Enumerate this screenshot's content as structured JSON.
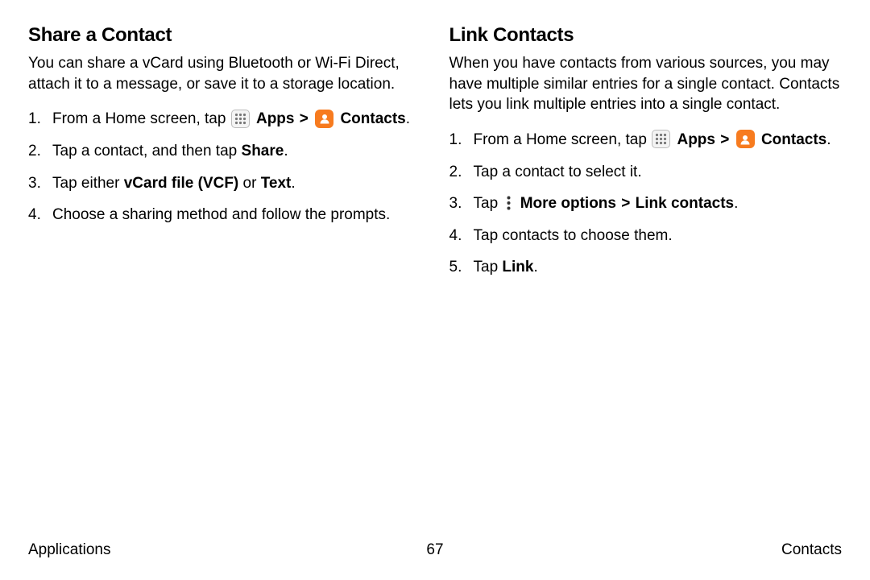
{
  "left": {
    "heading": "Share a Contact",
    "intro": "You can share a vCard using Bluetooth or Wi-Fi Direct, attach it to a message, or save it to a storage location.",
    "steps": {
      "s1_a": "From a Home screen, tap ",
      "s1_apps": "Apps",
      "s1_chev": ">",
      "s1_contacts": "Contacts",
      "s1_end": ".",
      "s2_a": "Tap a contact, and then tap ",
      "s2_b": "Share",
      "s2_end": ".",
      "s3_a": "Tap either ",
      "s3_b": "vCard file (VCF)",
      "s3_c": " or ",
      "s3_d": "Text",
      "s3_end": ".",
      "s4": "Choose a sharing method and follow the prompts."
    }
  },
  "right": {
    "heading": "Link Contacts",
    "intro": "When you have contacts from various sources, you may have multiple similar entries for a single contact. Contacts lets you link multiple entries into a single contact.",
    "steps": {
      "s1_a": "From a Home screen, tap ",
      "s1_apps": "Apps",
      "s1_chev": ">",
      "s1_contacts": "Contacts",
      "s1_end": ".",
      "s2": "Tap a contact to select it.",
      "s3_a": "Tap ",
      "s3_b": "More options",
      "s3_chev": ">",
      "s3_c": "Link contacts",
      "s3_end": ".",
      "s4": "Tap contacts to choose them.",
      "s5_a": "Tap ",
      "s5_b": "Link",
      "s5_end": "."
    }
  },
  "footer": {
    "left": "Applications",
    "center": "67",
    "right": "Contacts"
  }
}
